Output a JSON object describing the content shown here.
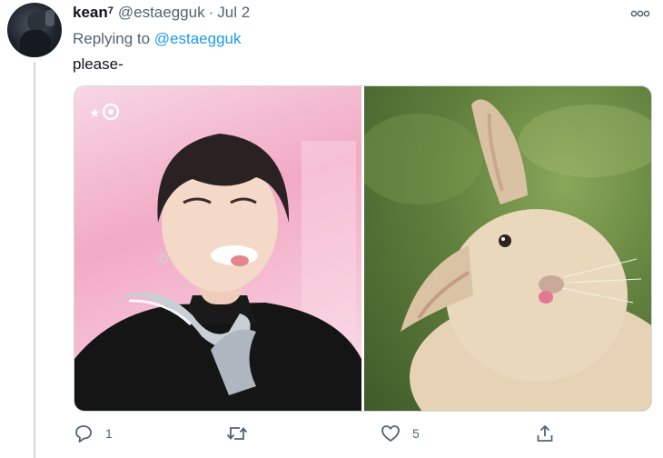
{
  "tweet": {
    "display_name": "kean",
    "name_superscript": "7",
    "handle": "@estaegguk",
    "separator": "·",
    "date": "Jul 2",
    "replying_prefix": "Replying to",
    "replying_to": "@estaegguk",
    "text": "please-"
  },
  "media": {
    "left_image": "photo of smiling person in black turtleneck holding silver trophy, pink background",
    "right_image": "photo of lop-eared rabbit sticking out tongue, green background"
  },
  "actions": {
    "reply_count": "1",
    "retweet_count": "",
    "like_count": "5"
  },
  "colors": {
    "text": "#0f1419",
    "muted": "#536471",
    "link": "#1d9bf0",
    "line": "#cfd9de"
  }
}
